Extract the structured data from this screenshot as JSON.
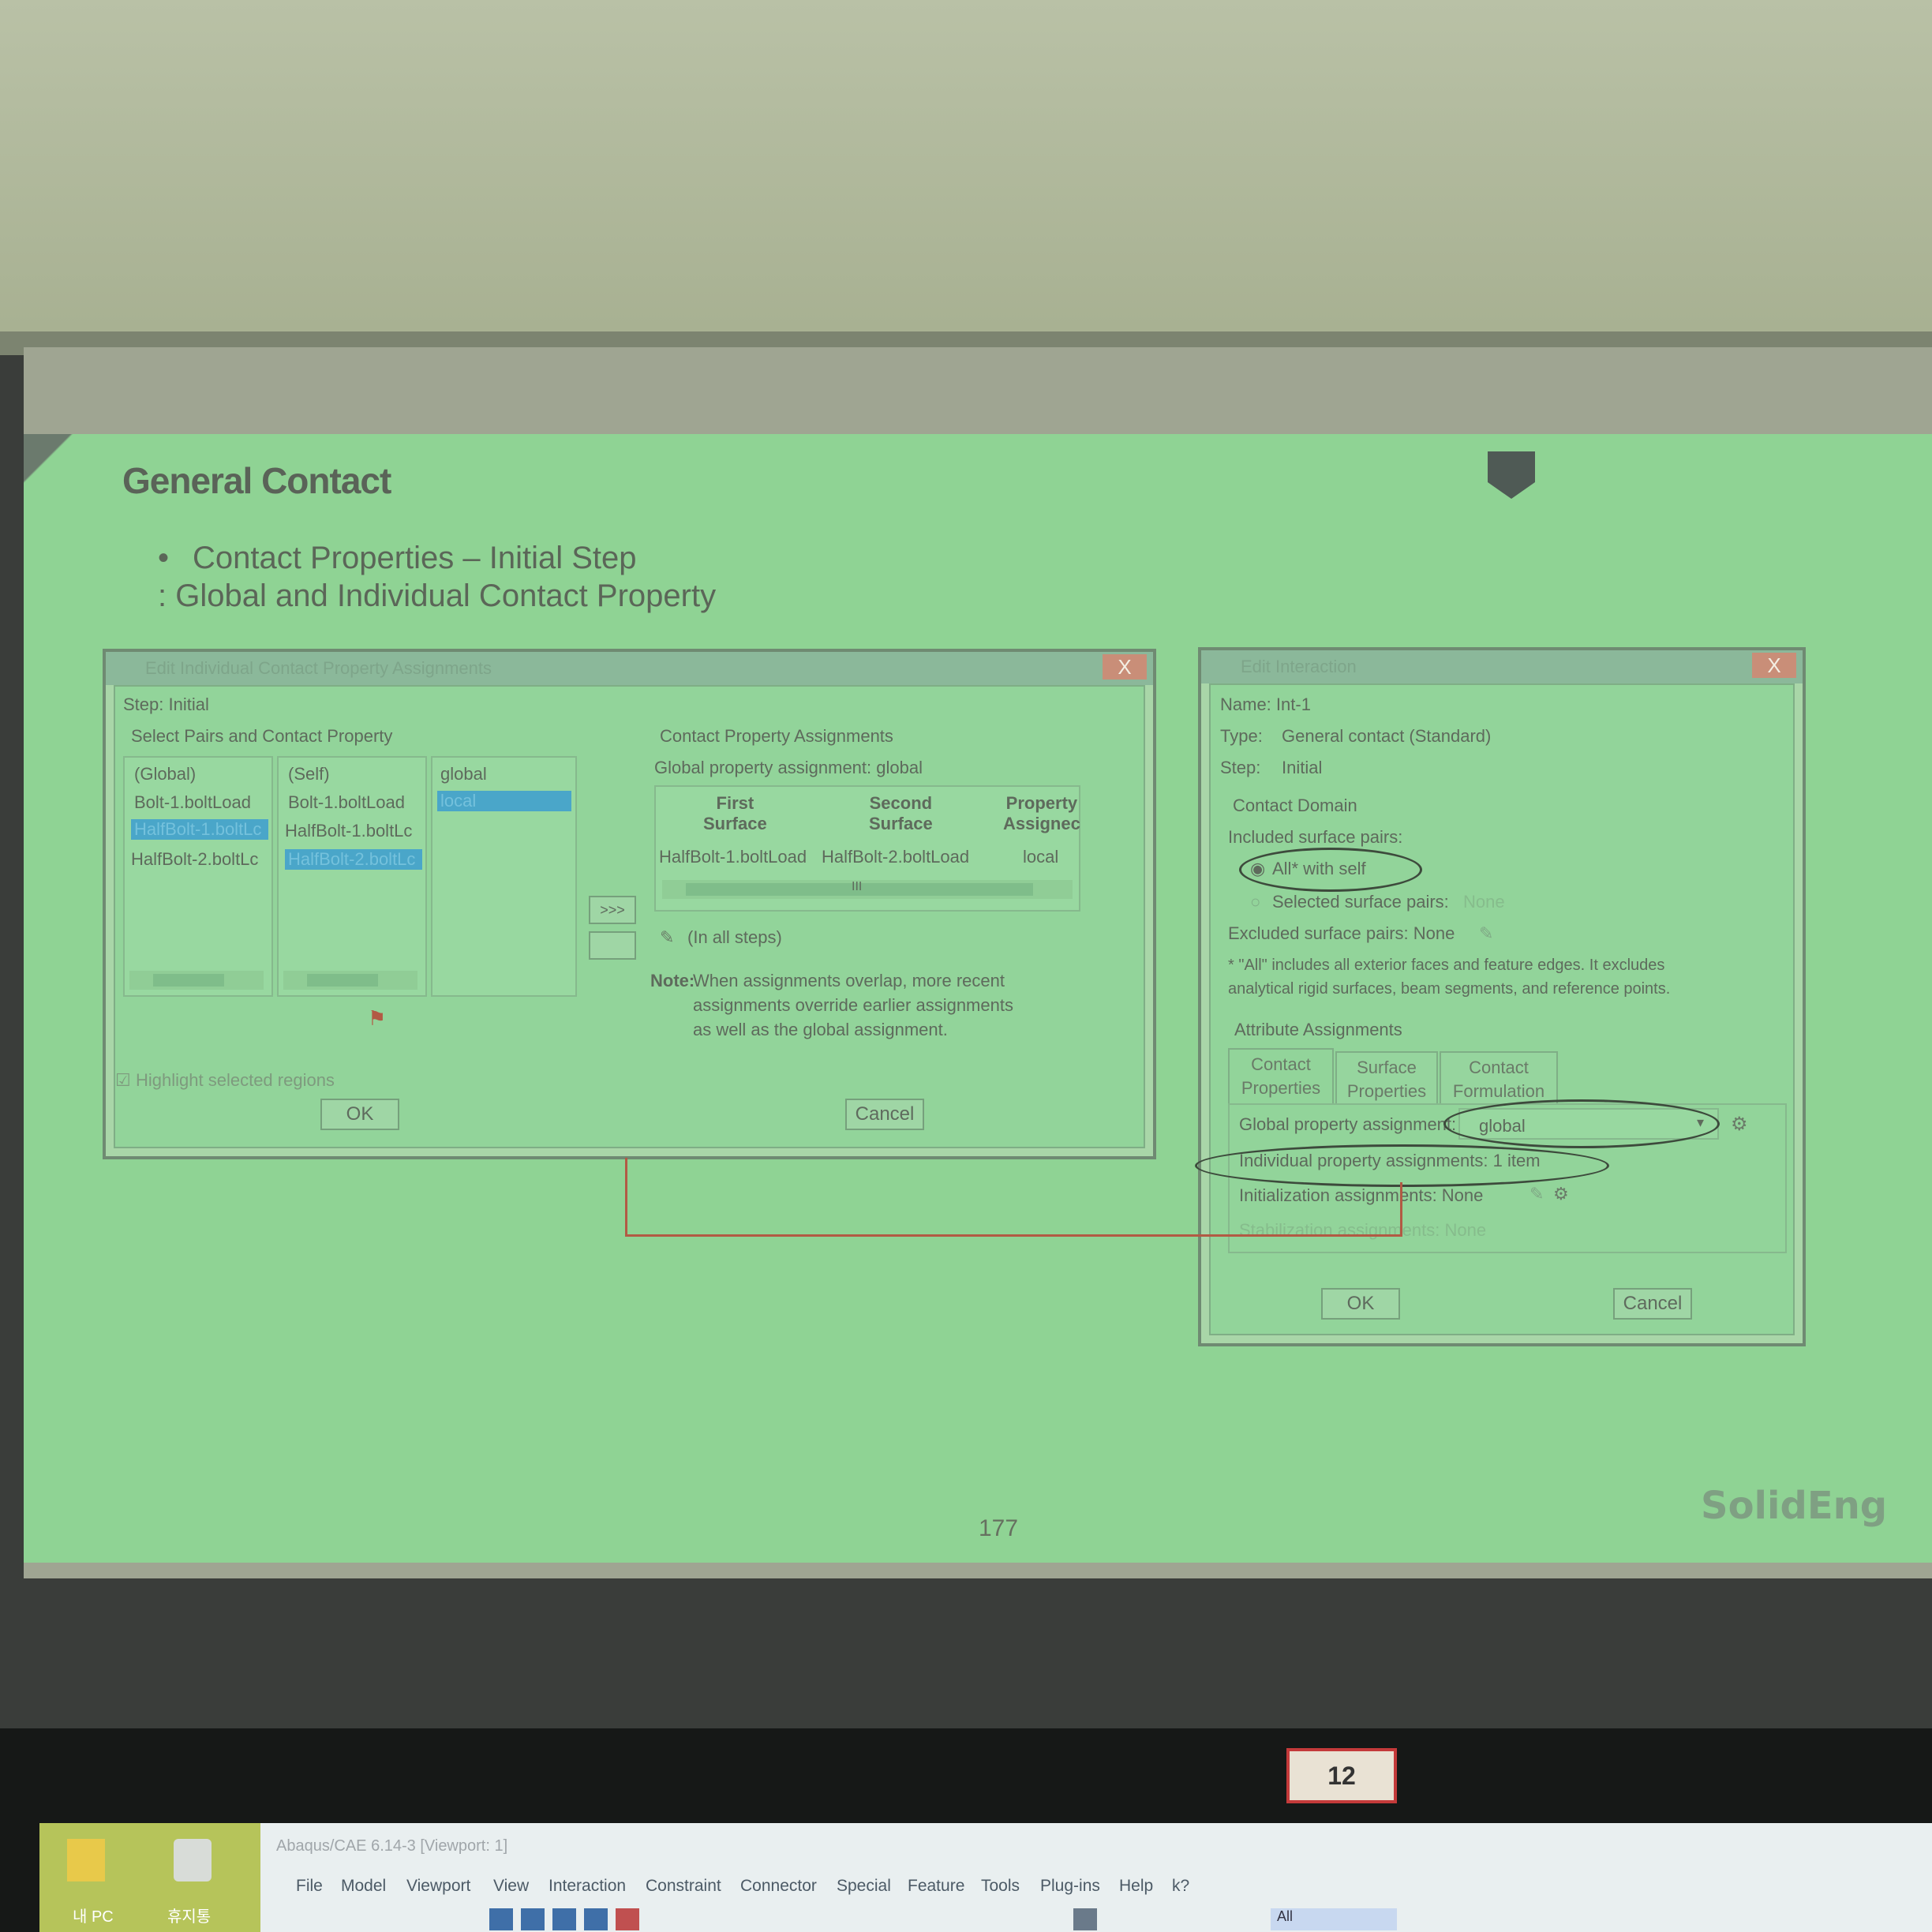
{
  "slide": {
    "title": "General Contact",
    "bullet": "Contact Properties – Initial Step",
    "subline": ": Global and Individual Contact Property",
    "page_number": "177",
    "logo": "SolidEng"
  },
  "left_dialog": {
    "title": "Edit Individual Contact Property Assignments",
    "close": "X",
    "step_label": "Step: Initial",
    "select_pairs_label": "Select Pairs and Contact Property",
    "col1": [
      "(Global)",
      "Bolt-1.boltLoad",
      "HalfBolt-1.boltLc",
      "HalfBolt-2.boltLc"
    ],
    "col2": [
      "(Self)",
      "Bolt-1.boltLoad",
      "HalfBolt-1.boltLc",
      "HalfBolt-2.boltLc"
    ],
    "col3": [
      "global",
      "local"
    ],
    "arrow_button": ">>>",
    "assignments_label": "Contact Property Assignments",
    "global_assignment": "Global property assignment: global",
    "table_headers": [
      "First Surface",
      "Second Surface",
      "Property Assigned"
    ],
    "table_headers_display": [
      "First\nSurface",
      "Second\nSurface",
      "Property\nAssignec"
    ],
    "table_row": [
      "HalfBolt-1.boltLoad",
      "HalfBolt-2.boltLoad",
      "local"
    ],
    "scroll_mid": "III",
    "in_all_steps": "(In all steps)",
    "note_label": "Note:",
    "note_text": [
      "When assignments overlap, more recent",
      "assignments override earlier assignments",
      "as well as the global assignment."
    ],
    "highlight": "Highlight selected regions",
    "ok": "OK",
    "cancel": "Cancel"
  },
  "right_dialog": {
    "title": "Edit Interaction",
    "close": "X",
    "name": "Name: Int-1",
    "type_label": "Type:",
    "type_value": "General contact (Standard)",
    "step_label": "Step:",
    "step_value": "Initial",
    "contact_domain": "Contact Domain",
    "included_pairs": "Included surface pairs:",
    "all_with_self": "All* with self",
    "selected_pairs": "Selected surface pairs:",
    "selected_pairs_value": "None",
    "excluded_pairs": "Excluded surface pairs: None",
    "footnote": [
      "* \"All\" includes all exterior faces and feature edges. It excludes",
      "analytical rigid surfaces, beam segments, and reference points."
    ],
    "attribute_assignments": "Attribute Assignments",
    "tabs": [
      [
        "Contact",
        "Properties"
      ],
      [
        "Surface",
        "Properties"
      ],
      [
        "Contact",
        "Formulation"
      ]
    ],
    "global_prop_label": "Global property assignment:",
    "global_prop_value": "global",
    "individual_prop": "Individual property assignments: 1 item",
    "init_assign": "Initialization assignments: None",
    "stabilization": "Stabilization assignments: None",
    "ok": "OK",
    "cancel": "Cancel"
  },
  "desktop": {
    "icon_labels": [
      "내 PC",
      "휴지통"
    ],
    "app_title": "Abaqus/CAE 6.14-3 [Viewport: 1]",
    "menu": [
      "File",
      "Model",
      "Viewport",
      "View",
      "Interaction",
      "Constraint",
      "Connector",
      "Special",
      "Feature",
      "Tools",
      "Plug-ins",
      "Help",
      "k?"
    ],
    "toolbar_field": "All",
    "monitor_tag": "12"
  },
  "colors": {
    "slide_bg": "#8fd394",
    "dialog_bg": "#92d49a",
    "selection": "#4aa6c9",
    "close_button": "#c98e78",
    "connector_line": "#b25a44"
  }
}
